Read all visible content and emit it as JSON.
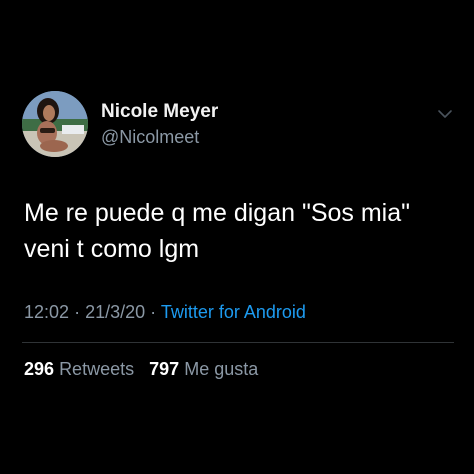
{
  "tweet": {
    "display_name": "Nicole Meyer",
    "handle": "@Nicolmeet",
    "text_lines": [
      "Me re puede q me digan \"Sos mia\"",
      "veni t como lgm"
    ],
    "time": "12:02",
    "separator": "·",
    "date": "21/3/20",
    "source": "Twitter for Android",
    "retweets_count": "296",
    "retweets_label": "Retweets",
    "likes_count": "797",
    "likes_label": "Me gusta"
  },
  "icons": {
    "avatar": "profile-photo",
    "menu": "chevron-down-icon"
  },
  "colors": {
    "background": "#000000",
    "text_primary": "#ffffff",
    "text_secondary": "#8b98a5",
    "link": "#1d9bf0",
    "divider": "#2f3336"
  }
}
